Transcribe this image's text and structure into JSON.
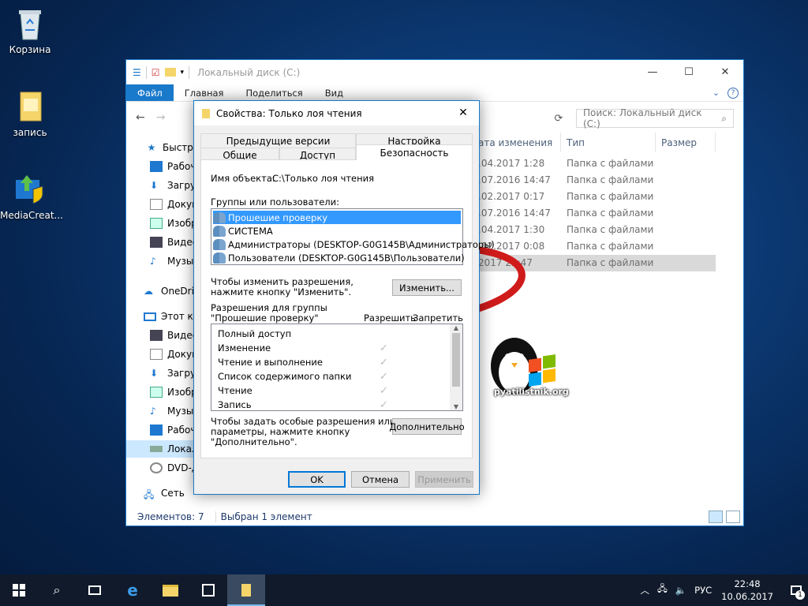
{
  "desktop": {
    "icons": [
      {
        "label": "Корзина",
        "icon": "recycle-bin-icon"
      },
      {
        "label": "запись",
        "icon": "folder-icon"
      },
      {
        "label": "MediaCreat...",
        "icon": "media-creation-tool-icon"
      }
    ]
  },
  "explorer": {
    "title": "Локальный диск (C:)",
    "ribbon_tabs": [
      "Файл",
      "Главная",
      "Поделиться",
      "Вид"
    ],
    "search_placeholder": "Поиск: Локальный диск (C:)",
    "columns": [
      "ата изменения",
      "Тип",
      "Размер"
    ],
    "rows": [
      {
        "date": ".04.2017 1:28",
        "type": "Папка с файлами"
      },
      {
        "date": ".07.2016 14:47",
        "type": "Папка с файлами"
      },
      {
        "date": ".02.2017 0:17",
        "type": "Папка с файлами"
      },
      {
        "date": ".07.2016 14:47",
        "type": "Папка с файлами"
      },
      {
        "date": ".04.2017 1:30",
        "type": "Папка с файлами"
      },
      {
        "date": ".02.2017 0:08",
        "type": "Папка с файлами"
      },
      {
        "date": "2017 22:47",
        "type": "Папка с файлами"
      }
    ],
    "nav_items": [
      {
        "label": "Быстрый",
        "icon": "star-icon"
      },
      {
        "label": "Рабоч",
        "icon": "desktop-icon"
      },
      {
        "label": "Загруз",
        "icon": "download-icon"
      },
      {
        "label": "Докум",
        "icon": "document-icon"
      },
      {
        "label": "Изобр",
        "icon": "pictures-icon"
      },
      {
        "label": "Видео",
        "icon": "video-icon"
      },
      {
        "label": "Музы",
        "icon": "music-icon"
      },
      {
        "label": "OneDriv",
        "icon": "onedrive-icon"
      },
      {
        "label": "Этот ко",
        "icon": "computer-icon"
      },
      {
        "label": "Видео",
        "icon": "video-icon"
      },
      {
        "label": "Докум",
        "icon": "document-icon"
      },
      {
        "label": "Загруз",
        "icon": "download-icon"
      },
      {
        "label": "Изобр",
        "icon": "pictures-icon"
      },
      {
        "label": "Музы",
        "icon": "music-icon"
      },
      {
        "label": "Рабоч",
        "icon": "desktop-icon"
      },
      {
        "label": "Локал",
        "icon": "drive-icon"
      },
      {
        "label": "DVD-д",
        "icon": "dvd-icon"
      },
      {
        "label": "Сеть",
        "icon": "network-icon"
      }
    ],
    "status_items": "Элементов: 7",
    "status_selected": "Выбран 1 элемент"
  },
  "dialog": {
    "title": "Свойства: Только лоя чтения",
    "tabs_top": [
      "Предыдущие версии",
      "Настройка"
    ],
    "tabs_bottom": [
      "Общие",
      "Доступ",
      "Безопасность"
    ],
    "object_label": "Имя объекта:",
    "object_value": "C:\\Только лоя чтения",
    "groups_label": "Группы или пользователи:",
    "groups": [
      "Прошешие проверку",
      "СИСТЕМА",
      "Администраторы (DESKTOP-G0G145B\\Администраторы)",
      "Пользователи (DESKTOP-G0G145B\\Пользователи)"
    ],
    "change_hint_1": "Чтобы изменить разрешения,",
    "change_hint_2": "нажмите кнопку \"Изменить\".",
    "change_button": "Изменить...",
    "perm_label_1": "Разрешения для группы",
    "perm_label_2": "\"Прошешие проверку\"",
    "allow_header": "Разрешить",
    "deny_header": "Запретить",
    "permissions": [
      {
        "name": "Полный доступ",
        "allow": false
      },
      {
        "name": "Изменение",
        "allow": true
      },
      {
        "name": "Чтение и выполнение",
        "allow": true
      },
      {
        "name": "Список содержимого папки",
        "allow": true
      },
      {
        "name": "Чтение",
        "allow": true
      },
      {
        "name": "Запись",
        "allow": true
      }
    ],
    "advanced_hint_1": "Чтобы задать особые разрешения или",
    "advanced_hint_2": "параметры, нажмите кнопку",
    "advanced_hint_3": "\"Дополнительно\".",
    "advanced_button": "Дополнительно",
    "ok_button": "OK",
    "cancel_button": "Отмена",
    "apply_button": "Применить"
  },
  "watermark": "pyatilistnik.org",
  "taskbar": {
    "language": "РУС",
    "time": "22:48",
    "date": "10.06.2017",
    "notifications": "1"
  }
}
